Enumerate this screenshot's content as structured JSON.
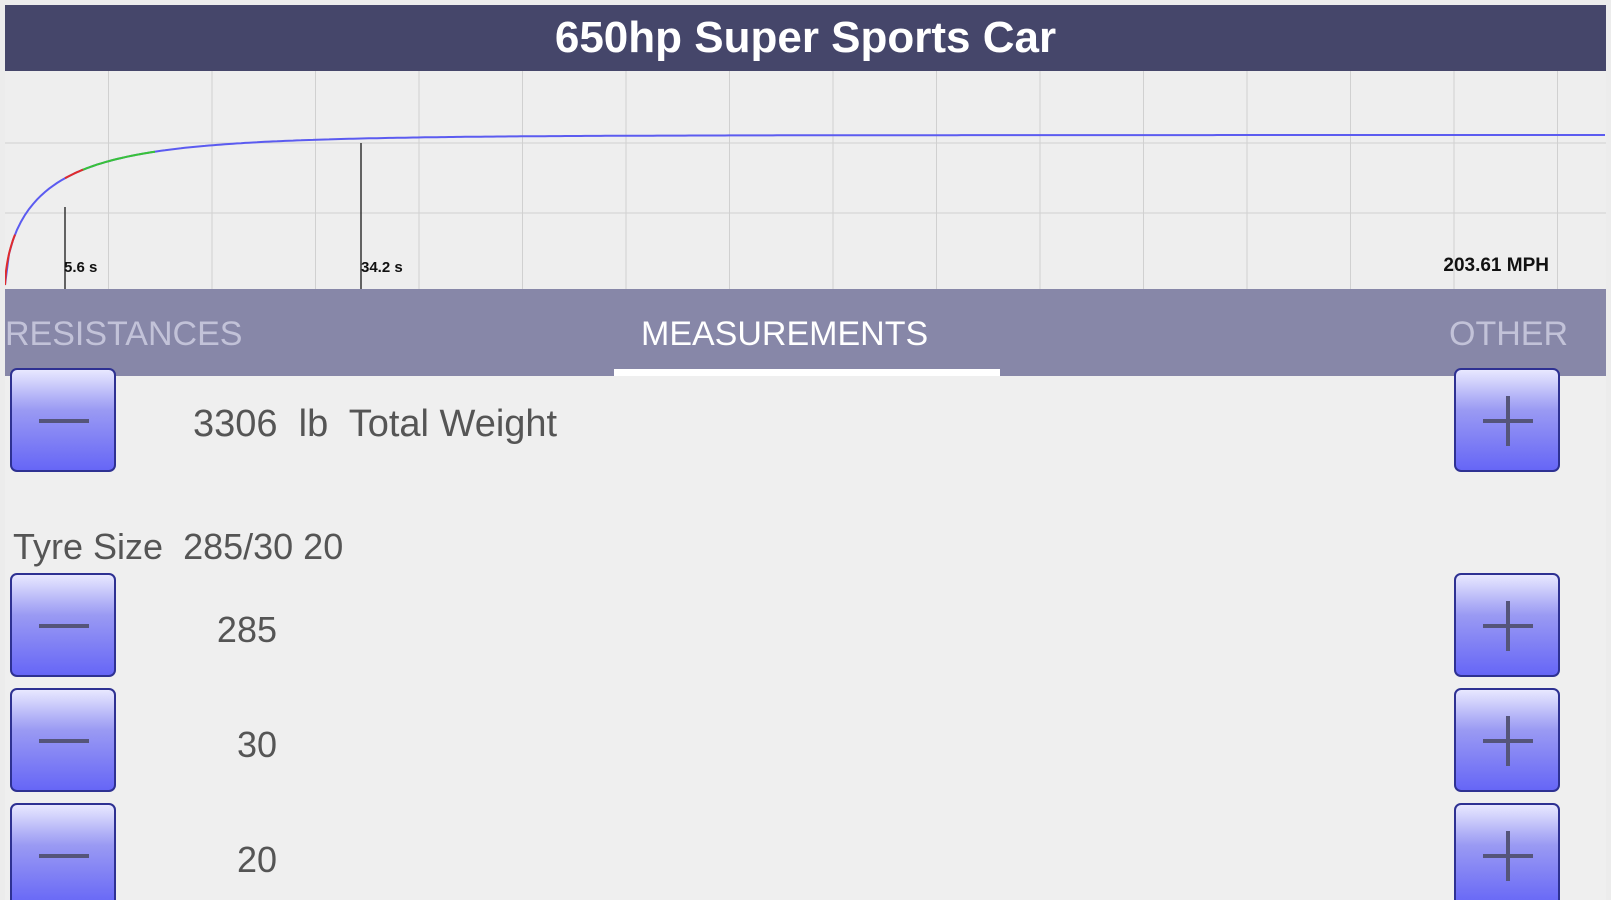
{
  "title": "650hp Super Sports Car",
  "graph": {
    "markers": [
      "5.6 s",
      "34.2 s"
    ],
    "top_speed_label": "203.61 MPH",
    "colors": {
      "line": "#5b5bf0",
      "green": "#38c238",
      "red": "#e02b2b",
      "grid": "#d0d0d0"
    }
  },
  "tabs": [
    {
      "label": "RESISTANCES",
      "active": false
    },
    {
      "label": "MEASUREMENTS",
      "active": true
    },
    {
      "label": "OTHER",
      "active": false
    }
  ],
  "weight": {
    "value": "3306",
    "unit": "lb",
    "label": "Total Weight"
  },
  "tyre": {
    "label": "Tyre Size",
    "size": "285/30 20",
    "width": "285",
    "aspect": "30",
    "rim": "20"
  },
  "icons": {
    "decrease": "minus-icon",
    "increase": "plus-icon"
  },
  "accent_color": "#6666f6"
}
